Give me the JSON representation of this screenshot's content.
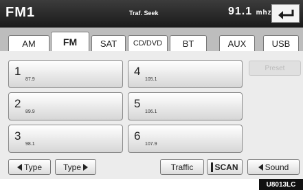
{
  "header": {
    "title": "FM1",
    "traffic_seek": "Traf. Seek",
    "frequency": "91.1",
    "frequency_unit": "mhz"
  },
  "tabs": [
    "AM",
    "FM",
    "SAT",
    "CD/DVD",
    "BT",
    "AUX",
    "USB"
  ],
  "active_tab": "FM",
  "presets": [
    {
      "num": "1",
      "freq": "87.9"
    },
    {
      "num": "2",
      "freq": "89.9"
    },
    {
      "num": "3",
      "freq": "98.1"
    },
    {
      "num": "4",
      "freq": "105.1"
    },
    {
      "num": "5",
      "freq": "106.1"
    },
    {
      "num": "6",
      "freq": "107.9"
    }
  ],
  "side_button": "Preset",
  "buttons": {
    "type_prev": "Type",
    "type_next": "Type",
    "traffic": "Traffic",
    "scan": "SCAN",
    "sound": "Sound"
  },
  "figure_code": "U8013LC",
  "icons": [
    "back-arrow-icon",
    "arrow-left-icon",
    "arrow-right-icon",
    "scan-bar-icon"
  ]
}
